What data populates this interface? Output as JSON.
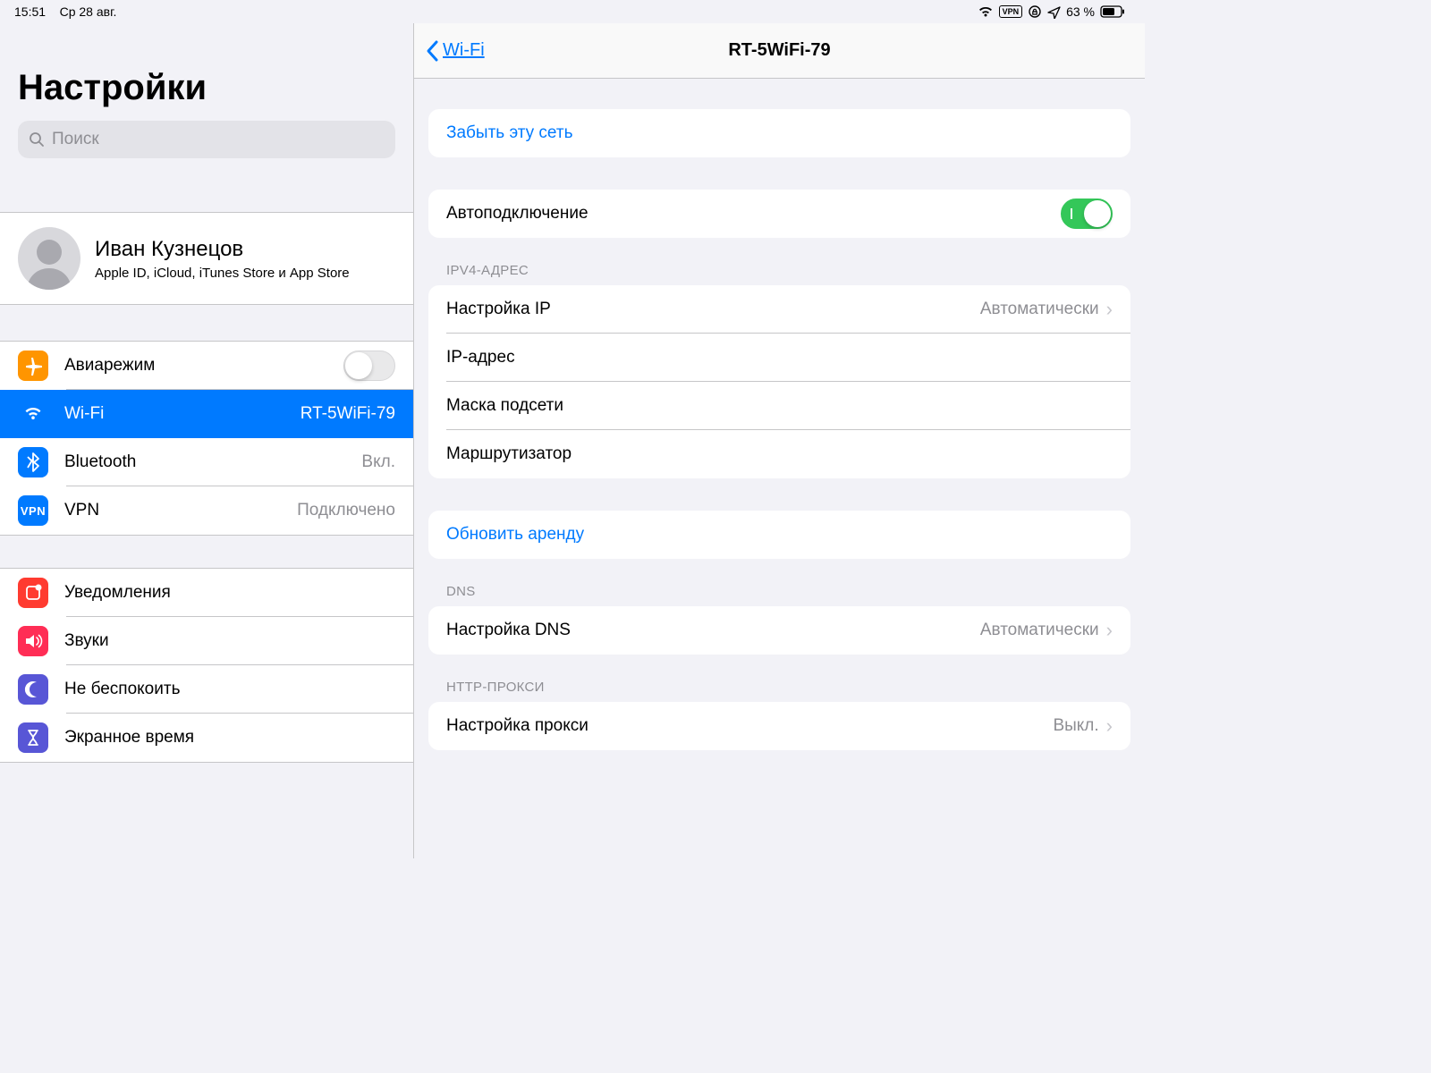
{
  "statusbar": {
    "time": "15:51",
    "date": "Ср 28 авг.",
    "vpn_label": "VPN",
    "battery": "63 %"
  },
  "sidebar": {
    "title": "Настройки",
    "search_placeholder": "Поиск",
    "profile": {
      "name": "Иван Кузнецов",
      "sub": "Apple ID, iCloud, iTunes Store и App Store"
    },
    "group1": [
      {
        "label": "Авиарежим",
        "value": "",
        "icon": "airplane",
        "selected": false,
        "toggle": "off"
      },
      {
        "label": "Wi-Fi",
        "value": "RT-5WiFi-79",
        "icon": "wifi",
        "selected": true
      },
      {
        "label": "Bluetooth",
        "value": "Вкл.",
        "icon": "bluetooth",
        "selected": false
      },
      {
        "label": "VPN",
        "value": "Подключено",
        "icon": "vpn",
        "selected": false
      }
    ],
    "group2": [
      {
        "label": "Уведомления",
        "icon": "notify"
      },
      {
        "label": "Звуки",
        "icon": "sounds"
      },
      {
        "label": "Не беспокоить",
        "icon": "dnd"
      },
      {
        "label": "Экранное время",
        "icon": "screentime"
      }
    ]
  },
  "detail": {
    "back_label": "Wi-Fi",
    "title": "RT-5WiFi-79",
    "forget": "Забыть эту сеть",
    "autojoin_label": "Автоподключение",
    "ipv4_header": "IPV4-АДРЕС",
    "ipv4": [
      {
        "label": "Настройка IP",
        "value": "Автоматически",
        "chevron": true
      },
      {
        "label": "IP-адрес",
        "value": "",
        "chevron": false
      },
      {
        "label": "Маска подсети",
        "value": "",
        "chevron": false
      },
      {
        "label": "Маршрутизатор",
        "value": "",
        "chevron": false
      }
    ],
    "renew": "Обновить аренду",
    "dns_header": "DNS",
    "dns": {
      "label": "Настройка DNS",
      "value": "Автоматически"
    },
    "proxy_header": "HTTP-ПРОКСИ",
    "proxy": {
      "label": "Настройка прокси",
      "value": "Выкл."
    }
  }
}
